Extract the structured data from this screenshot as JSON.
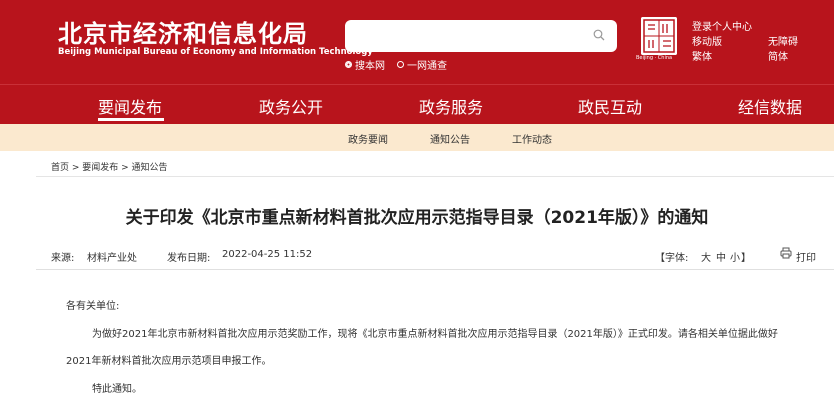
{
  "header": {
    "title_cn": "北京市经济和信息化局",
    "title_en": "Beijing Municipal Bureau of Economy and Information Technology",
    "search": {
      "placeholder": ""
    },
    "radio_options": [
      "搜本网",
      "一网通查"
    ],
    "selected_radio": "搜本网",
    "seal_caption": "Beijing · China",
    "links": {
      "login": "登录个人中心",
      "mobile": "移动版",
      "barrier_free": "无障碍",
      "traditional": "繁体",
      "simplified": "简体"
    }
  },
  "colors": {
    "brand": "#b8141c",
    "subnav_bg": "#fbe9cf"
  },
  "nav": {
    "items": [
      "要闻发布",
      "政务公开",
      "政务服务",
      "政民互动",
      "经信数据"
    ],
    "active": "要闻发布"
  },
  "subnav": {
    "items": [
      "政务要闻",
      "通知公告",
      "工作动态"
    ],
    "active": "通知公告"
  },
  "breadcrumb": "首页 > 要闻发布 > 通知公告",
  "article": {
    "title": "关于印发《北京市重点新材料首批次应用示范指导目录（2021年版）》的通知",
    "source_label": "来源:",
    "source": "材料产业处",
    "date_label": "发布日期:",
    "date": "2022-04-25 11:52",
    "font_label": "【字体:",
    "font_sizes": [
      "大",
      "中",
      "小"
    ],
    "font_close": "】",
    "print": "打印",
    "salutation": "各有关单位:",
    "para1_line1": "为做好2021年北京市新材料首批次应用示范奖励工作，现将《北京市重点新材料首批次应用示范指导目录（2021年版）》正式印发。请各相关单位据此做好",
    "para1_line2": "2021年新材料首批次应用示范项目申报工作。",
    "closing": "特此通知。"
  },
  "icons": [
    "search-icon",
    "print-icon"
  ]
}
